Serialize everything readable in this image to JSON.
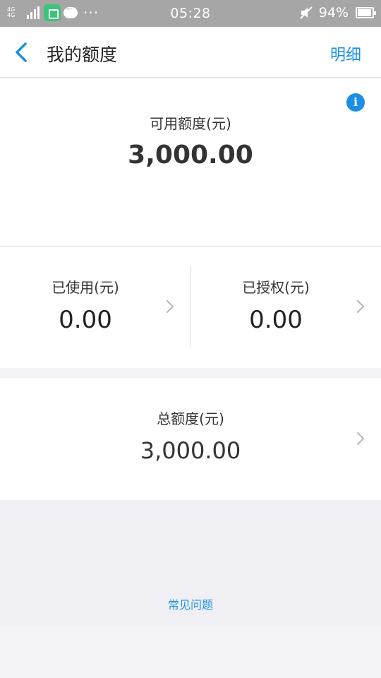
{
  "status_bar": {
    "signal_left": "4G 4G",
    "time": "05:28",
    "battery": "94%"
  },
  "nav": {
    "title": "我的额度",
    "detail": "明细",
    "back_icon": "chevron-left-icon"
  },
  "available": {
    "label": "可用额度(元)",
    "amount": "3,000.00",
    "info_icon": "info-icon"
  },
  "used": {
    "label": "已使用(元)",
    "value": "0.00"
  },
  "authorized": {
    "label": "已授权(元)",
    "value": "0.00"
  },
  "total": {
    "label": "总额度(元)",
    "value": "3,000.00"
  },
  "faq": {
    "label": "常见问题"
  },
  "colors": {
    "accent": "#1a8fe3",
    "status_bar": "#a6a6a6",
    "page_bg": "#f4f4f6"
  }
}
